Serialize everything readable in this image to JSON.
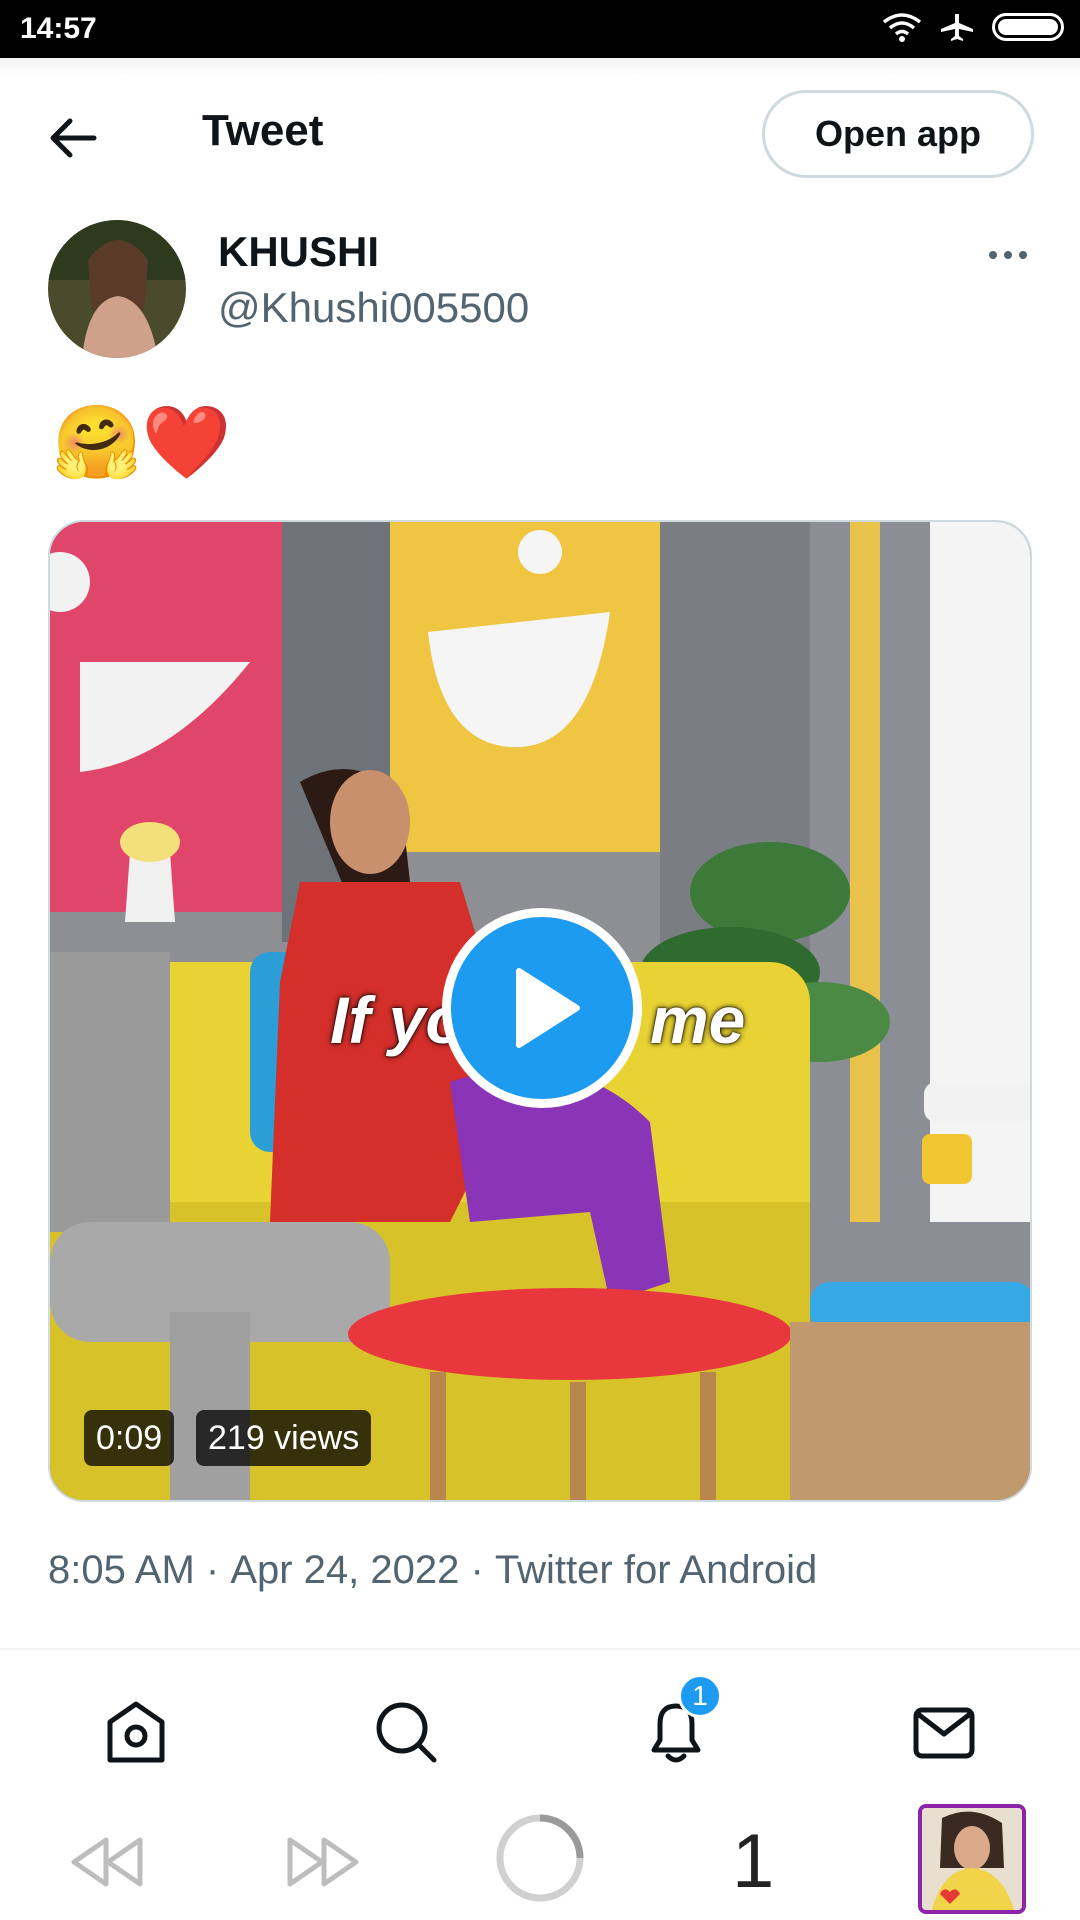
{
  "status_bar": {
    "time": "14:57"
  },
  "header": {
    "title": "Tweet",
    "open_app_label": "Open app"
  },
  "tweet": {
    "author_name": "KHUSHI",
    "author_handle": "@Khushi005500",
    "text": "🤗❤️",
    "video": {
      "caption_left": "If yo",
      "caption_right": "me",
      "duration": "0:09",
      "views": "219 views"
    },
    "time": "8:05 AM",
    "separator": " · ",
    "date": "Apr 24, 2022",
    "source": "Twitter for Android"
  },
  "bottom_nav": {
    "items": [
      "home-icon",
      "search-icon",
      "notifications-icon",
      "messages-icon"
    ],
    "notification_count": "1"
  },
  "media_strip": {
    "page": "1"
  },
  "colors": {
    "accent": "#1d9bf0",
    "secondary_text": "#536471",
    "border": "#cfd9de"
  }
}
